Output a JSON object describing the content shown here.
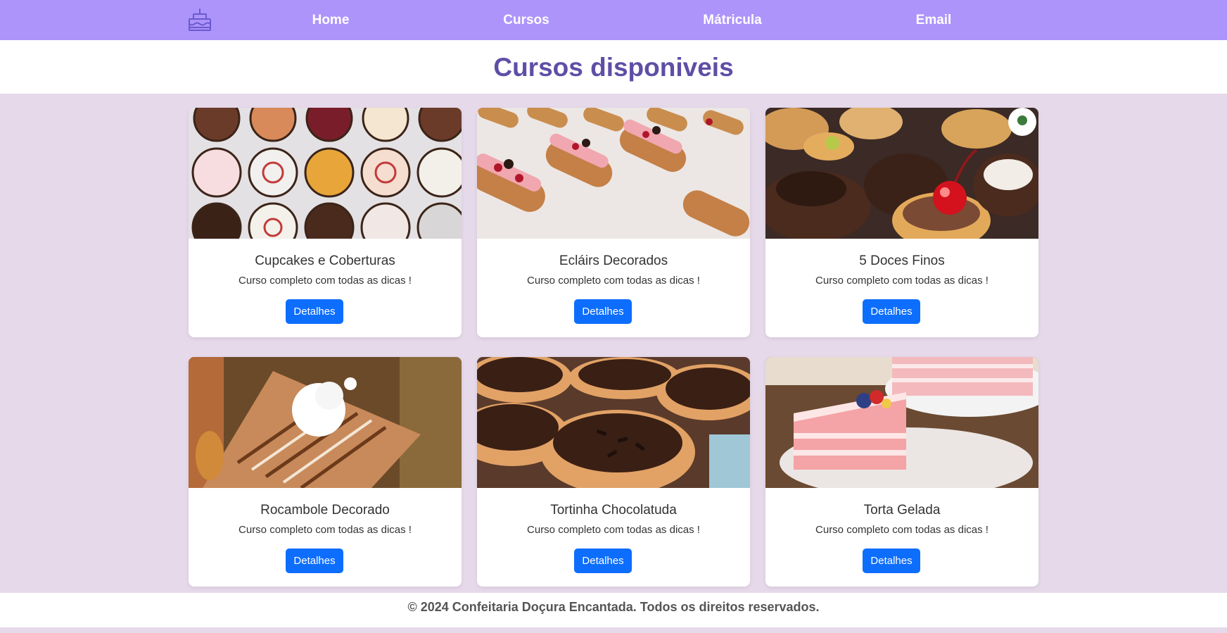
{
  "nav": {
    "logo_icon": "cake-icon",
    "items": [
      {
        "label": "Home"
      },
      {
        "label": "Cursos"
      },
      {
        "label": "Mátricula"
      },
      {
        "label": "Email"
      }
    ]
  },
  "page": {
    "title": "Cursos disponiveis"
  },
  "courses": [
    {
      "title": "Cupcakes e Coberturas",
      "description": "Curso completo com todas as dicas !",
      "button": "Detalhes"
    },
    {
      "title": "Ecláirs Decorados",
      "description": "Curso completo com todas as dicas !",
      "button": "Detalhes"
    },
    {
      "title": "5 Doces Finos",
      "description": "Curso completo com todas as dicas !",
      "button": "Detalhes"
    },
    {
      "title": "Rocambole Decorado",
      "description": "Curso completo com todas as dicas !",
      "button": "Detalhes"
    },
    {
      "title": "Tortinha Chocolatuda",
      "description": "Curso completo com todas as dicas !",
      "button": "Detalhes"
    },
    {
      "title": "Torta Gelada",
      "description": "Curso completo com todas as dicas !",
      "button": "Detalhes"
    }
  ],
  "footer": {
    "text": "© 2024 Confeitaria Doçura Encantada. Todos os direitos reservados."
  },
  "colors": {
    "navbar": "#ad94fb",
    "page_background": "#e6d9ea",
    "title": "#5f4ea6",
    "button": "#0d6efd"
  }
}
